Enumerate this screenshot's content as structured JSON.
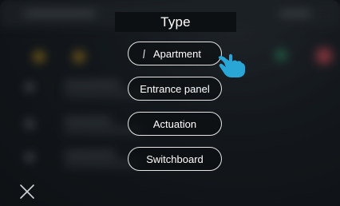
{
  "dialog": {
    "title": "Type",
    "options": [
      {
        "label": "Apartment",
        "state": "pressed"
      },
      {
        "label": "Entrance panel"
      },
      {
        "label": "Actuation"
      },
      {
        "label": "Switchboard"
      }
    ]
  },
  "icons": {
    "pointer": "hand-pointer-icon",
    "close": "close-icon"
  },
  "colors": {
    "accent": "#2aa6d6",
    "background": "#14181c",
    "button_border": "#e6e6e6",
    "text": "#ffffff"
  }
}
